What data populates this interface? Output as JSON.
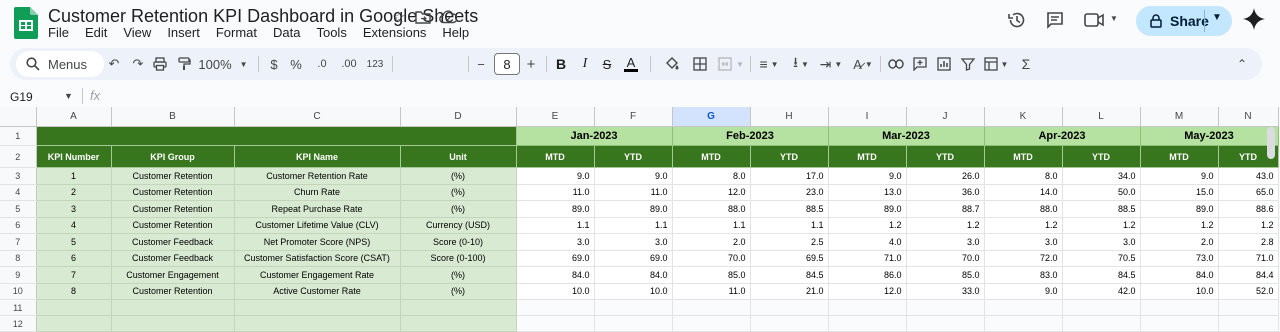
{
  "app": {
    "title": "Customer Retention KPI Dashboard in Google Sheets",
    "menu": [
      "File",
      "Edit",
      "View",
      "Insert",
      "Format",
      "Data",
      "Tools",
      "Extensions",
      "Help"
    ],
    "share_label": "Share",
    "colors": {
      "dark_green": "#38761d",
      "light_green": "#d9ead3",
      "month_green": "#b6e2a1",
      "share_bg": "#c2e7ff"
    }
  },
  "toolbar": {
    "search_label": "Menus",
    "zoom": "100%",
    "currency": "$",
    "percent": "%",
    "dec_decrease": ".0",
    "dec_increase": ".00",
    "num_format": "123",
    "font_size": "8",
    "minus": "−",
    "plus": "+"
  },
  "formula_bar": {
    "cell_ref": "G19",
    "fx": "fx"
  },
  "grid": {
    "columns": [
      "A",
      "B",
      "C",
      "D",
      "E",
      "F",
      "G",
      "H",
      "I",
      "J",
      "K",
      "L",
      "M",
      "N"
    ],
    "selected_column": "G",
    "row_numbers": [
      "1",
      "2",
      "3",
      "4",
      "5",
      "6",
      "7",
      "8",
      "9",
      "10",
      "11",
      "12"
    ],
    "months": [
      "Jan-2023",
      "Feb-2023",
      "Mar-2023",
      "Apr-2023",
      "May-2023"
    ],
    "headers": {
      "kpi_number": "KPI Number",
      "kpi_group": "KPI Group",
      "kpi_name": "KPI Name",
      "unit": "Unit",
      "mtd": "MTD",
      "ytd": "YTD"
    },
    "rows": [
      {
        "num": "1",
        "group": "Customer Retention",
        "name": "Customer Retention Rate",
        "unit": "(%)",
        "values": [
          "9.0",
          "9.0",
          "8.0",
          "17.0",
          "9.0",
          "26.0",
          "8.0",
          "34.0",
          "9.0",
          "43.0"
        ]
      },
      {
        "num": "2",
        "group": "Customer Retention",
        "name": "Churn Rate",
        "unit": "(%)",
        "values": [
          "11.0",
          "11.0",
          "12.0",
          "23.0",
          "13.0",
          "36.0",
          "14.0",
          "50.0",
          "15.0",
          "65.0"
        ]
      },
      {
        "num": "3",
        "group": "Customer Retention",
        "name": "Repeat Purchase Rate",
        "unit": "(%)",
        "values": [
          "89.0",
          "89.0",
          "88.0",
          "88.5",
          "89.0",
          "88.7",
          "88.0",
          "88.5",
          "89.0",
          "88.6"
        ]
      },
      {
        "num": "4",
        "group": "Customer Retention",
        "name": "Customer Lifetime Value (CLV)",
        "unit": "Currency (USD)",
        "values": [
          "1.1",
          "1.1",
          "1.1",
          "1.1",
          "1.2",
          "1.2",
          "1.2",
          "1.2",
          "1.2",
          "1.2"
        ]
      },
      {
        "num": "5",
        "group": "Customer Feedback",
        "name": "Net Promoter Score (NPS)",
        "unit": "Score (0-10)",
        "values": [
          "3.0",
          "3.0",
          "2.0",
          "2.5",
          "4.0",
          "3.0",
          "3.0",
          "3.0",
          "2.0",
          "2.8"
        ]
      },
      {
        "num": "6",
        "group": "Customer Feedback",
        "name": "Customer Satisfaction Score (CSAT)",
        "unit": "Score (0-100)",
        "values": [
          "69.0",
          "69.0",
          "70.0",
          "69.5",
          "71.0",
          "70.0",
          "72.0",
          "70.5",
          "73.0",
          "71.0"
        ]
      },
      {
        "num": "7",
        "group": "Customer Engagement",
        "name": "Customer Engagement Rate",
        "unit": "(%)",
        "values": [
          "84.0",
          "84.0",
          "85.0",
          "84.5",
          "86.0",
          "85.0",
          "83.0",
          "84.5",
          "84.0",
          "84.4"
        ]
      },
      {
        "num": "8",
        "group": "Customer Retention",
        "name": "Active Customer Rate",
        "unit": "(%)",
        "values": [
          "10.0",
          "10.0",
          "11.0",
          "21.0",
          "12.0",
          "33.0",
          "9.0",
          "42.0",
          "10.0",
          "52.0"
        ]
      }
    ]
  }
}
